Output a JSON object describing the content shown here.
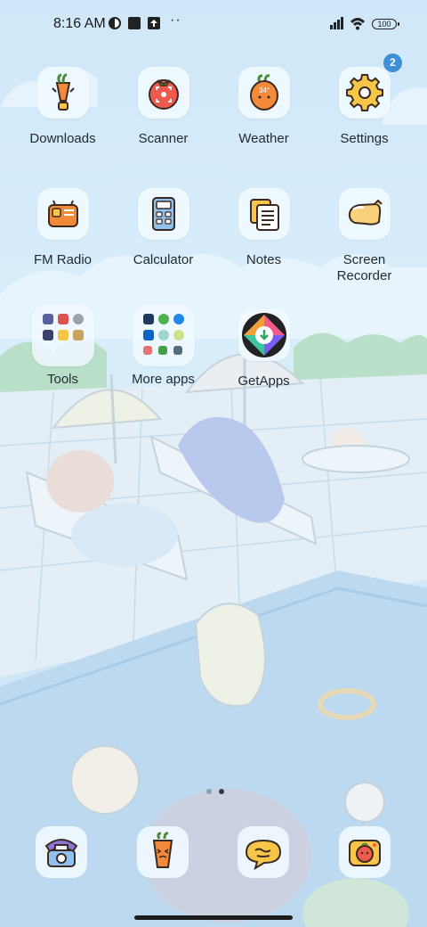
{
  "status_bar": {
    "time": "8:16 AM",
    "battery": "100",
    "overflow": "··",
    "icons": [
      "signal-icon",
      "wifi-icon",
      "battery-icon",
      "notification-icon",
      "square-icon",
      "upload-icon"
    ]
  },
  "apps": [
    {
      "label": "Downloads",
      "icon": "downloads-carrot-icon"
    },
    {
      "label": "Scanner",
      "icon": "tomato-scanner-icon"
    },
    {
      "label": "Weather",
      "icon": "carrot-weather-icon",
      "temp_text": "34°"
    },
    {
      "label": "Settings",
      "icon": "gear-icon",
      "badge": "2"
    },
    {
      "label": "FM Radio",
      "icon": "radio-icon"
    },
    {
      "label": "Calculator",
      "icon": "calculator-icon"
    },
    {
      "label": "Notes",
      "icon": "notes-icon"
    },
    {
      "label": "Screen Recorder",
      "icon": "screen-recorder-icon"
    },
    {
      "label": "Tools",
      "icon": "folder-icon"
    },
    {
      "label": "More apps",
      "icon": "folder-icon"
    },
    {
      "label": "GetApps",
      "icon": "getapps-icon"
    }
  ],
  "dock": [
    {
      "icon": "phone-icon"
    },
    {
      "icon": "contacts-carrot-icon"
    },
    {
      "icon": "messages-icon"
    },
    {
      "icon": "camera-icon"
    }
  ],
  "page_indicator": {
    "count": 2,
    "active": 2
  },
  "colors": {
    "accent": "#3d8fd6",
    "wallpaper": "#d6ecfa"
  }
}
